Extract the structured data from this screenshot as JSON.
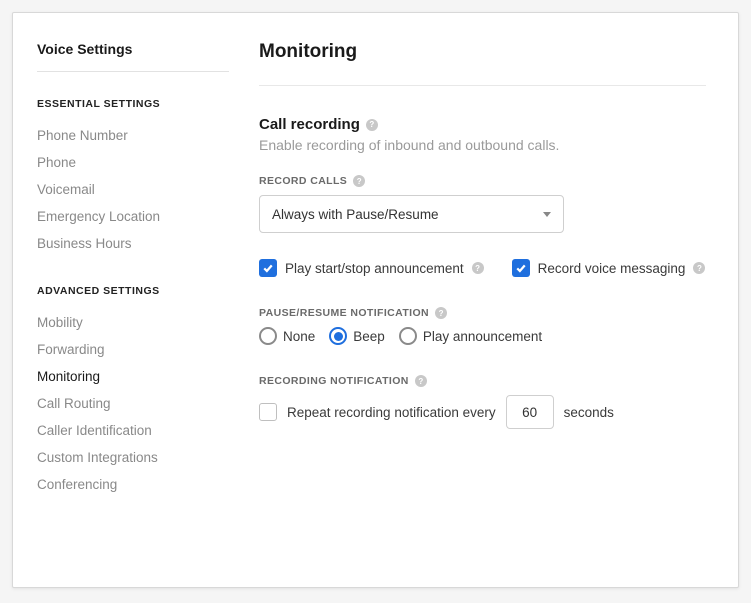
{
  "sidebar": {
    "title": "Voice Settings",
    "groups": [
      {
        "label": "Essential Settings",
        "items": [
          "Phone Number",
          "Phone",
          "Voicemail",
          "Emergency Location",
          "Business Hours"
        ]
      },
      {
        "label": "Advanced Settings",
        "items": [
          "Mobility",
          "Forwarding",
          "Monitoring",
          "Call Routing",
          "Caller Identification",
          "Custom Integrations",
          "Conferencing"
        ]
      }
    ],
    "active": "Monitoring"
  },
  "main": {
    "title": "Monitoring",
    "section": {
      "title": "Call recording",
      "desc": "Enable recording of inbound and outbound calls."
    },
    "recordCalls": {
      "label": "Record Calls",
      "value": "Always with Pause/Resume"
    },
    "checkboxes": {
      "playAnnouncement": {
        "label": "Play start/stop announcement",
        "checked": true
      },
      "recordVoiceMsg": {
        "label": "Record voice messaging",
        "checked": true
      }
    },
    "pauseResume": {
      "label": "Pause/Resume Notification",
      "options": [
        "None",
        "Beep",
        "Play announcement"
      ],
      "selected": "Beep"
    },
    "recordingNotification": {
      "label": "Recording Notification",
      "repeatPrefix": "Repeat recording notification every",
      "repeatValue": "60",
      "repeatSuffix": "seconds",
      "checked": false
    }
  },
  "help": "?"
}
